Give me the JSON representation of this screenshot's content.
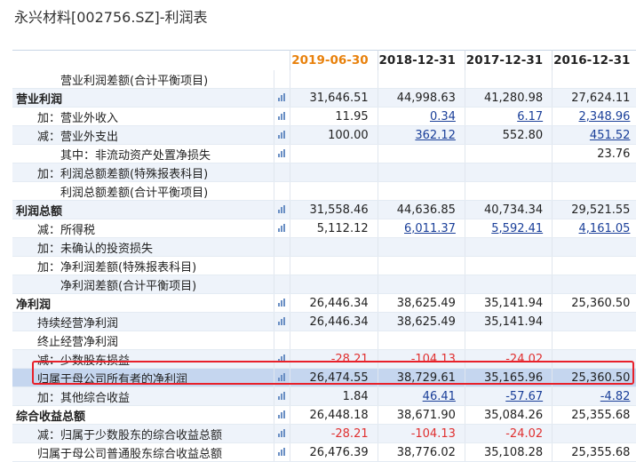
{
  "title": "永兴材料[002756.SZ]-利润表",
  "columns": [
    {
      "label": "2019-06-30",
      "accent": true
    },
    {
      "label": "2018-12-31",
      "accent": false
    },
    {
      "label": "2017-12-31",
      "accent": false
    },
    {
      "label": "2016-12-31",
      "accent": false
    }
  ],
  "rows": [
    {
      "label": "营业利润差额(合计平衡项目)",
      "indent": 3,
      "bold": false,
      "icon": false,
      "values": [
        "",
        "",
        "",
        ""
      ]
    },
    {
      "label": "营业利润",
      "indent": 0,
      "bold": true,
      "icon": true,
      "values": [
        "31,646.51",
        "44,998.63",
        "41,280.98",
        "27,624.11"
      ]
    },
    {
      "label": "加：营业外收入",
      "indent": 1,
      "bold": false,
      "icon": true,
      "values": [
        "11.95",
        "0.34",
        "6.17",
        "2,348.96"
      ],
      "links": [
        false,
        true,
        true,
        true
      ]
    },
    {
      "label": "减：营业外支出",
      "indent": 1,
      "bold": false,
      "icon": true,
      "values": [
        "100.00",
        "362.12",
        "552.80",
        "451.52"
      ],
      "links": [
        false,
        true,
        false,
        true
      ]
    },
    {
      "label": "其中：非流动资产处置净损失",
      "indent": 2,
      "bold": false,
      "icon": true,
      "values": [
        "",
        "",
        "",
        "23.76"
      ]
    },
    {
      "label": "加：利润总额差额(特殊报表科目)",
      "indent": 1,
      "bold": false,
      "icon": false,
      "values": [
        "",
        "",
        "",
        ""
      ]
    },
    {
      "label": "利润总额差额(合计平衡项目)",
      "indent": 3,
      "bold": false,
      "icon": false,
      "values": [
        "",
        "",
        "",
        ""
      ]
    },
    {
      "label": "利润总额",
      "indent": 0,
      "bold": true,
      "icon": true,
      "values": [
        "31,558.46",
        "44,636.85",
        "40,734.34",
        "29,521.55"
      ]
    },
    {
      "label": "减：所得税",
      "indent": 1,
      "bold": false,
      "icon": true,
      "values": [
        "5,112.12",
        "6,011.37",
        "5,592.41",
        "4,161.05"
      ],
      "links": [
        false,
        true,
        true,
        true
      ]
    },
    {
      "label": "加：未确认的投资损失",
      "indent": 1,
      "bold": false,
      "icon": false,
      "values": [
        "",
        "",
        "",
        ""
      ]
    },
    {
      "label": "加：净利润差额(特殊报表科目)",
      "indent": 1,
      "bold": false,
      "icon": false,
      "values": [
        "",
        "",
        "",
        ""
      ]
    },
    {
      "label": "净利润差额(合计平衡项目)",
      "indent": 3,
      "bold": false,
      "icon": false,
      "values": [
        "",
        "",
        "",
        ""
      ]
    },
    {
      "label": "净利润",
      "indent": 0,
      "bold": true,
      "icon": true,
      "values": [
        "26,446.34",
        "38,625.49",
        "35,141.94",
        "25,360.50"
      ]
    },
    {
      "label": "持续经营净利润",
      "indent": 1,
      "bold": false,
      "icon": true,
      "values": [
        "26,446.34",
        "38,625.49",
        "35,141.94",
        ""
      ]
    },
    {
      "label": "终止经营净利润",
      "indent": 1,
      "bold": false,
      "icon": false,
      "values": [
        "",
        "",
        "",
        ""
      ]
    },
    {
      "label": "减：少数股东损益",
      "indent": 1,
      "bold": false,
      "icon": true,
      "values": [
        "-28.21",
        "-104.13",
        "-24.02",
        ""
      ],
      "neg": [
        true,
        true,
        true,
        false
      ]
    },
    {
      "label": "归属于母公司所有者的净利润",
      "indent": 1,
      "bold": false,
      "icon": true,
      "highlight": true,
      "values": [
        "26,474.55",
        "38,729.61",
        "35,165.96",
        "25,360.50"
      ]
    },
    {
      "label": "加：其他综合收益",
      "indent": 1,
      "bold": false,
      "icon": true,
      "values": [
        "1.84",
        "46.41",
        "-57.67",
        "-4.82"
      ],
      "links": [
        false,
        true,
        true,
        true
      ],
      "neg": [
        false,
        false,
        true,
        true
      ]
    },
    {
      "label": "综合收益总额",
      "indent": 0,
      "bold": true,
      "icon": true,
      "values": [
        "26,448.18",
        "38,671.90",
        "35,084.26",
        "25,355.68"
      ]
    },
    {
      "label": "减：归属于少数股东的综合收益总额",
      "indent": 1,
      "bold": false,
      "icon": true,
      "values": [
        "-28.21",
        "-104.13",
        "-24.02",
        ""
      ],
      "neg": [
        true,
        true,
        true,
        false
      ]
    },
    {
      "label": "归属于母公司普通股东综合收益总额",
      "indent": 1,
      "bold": false,
      "icon": true,
      "values": [
        "26,476.39",
        "38,776.02",
        "35,108.28",
        "25,355.68"
      ]
    }
  ],
  "icon_name": "bar-chart-icon",
  "colors": {
    "accent_header": "#e8810c",
    "negative": "#e03030",
    "link": "#1a3f99",
    "highlight_border": "#e8202a"
  }
}
